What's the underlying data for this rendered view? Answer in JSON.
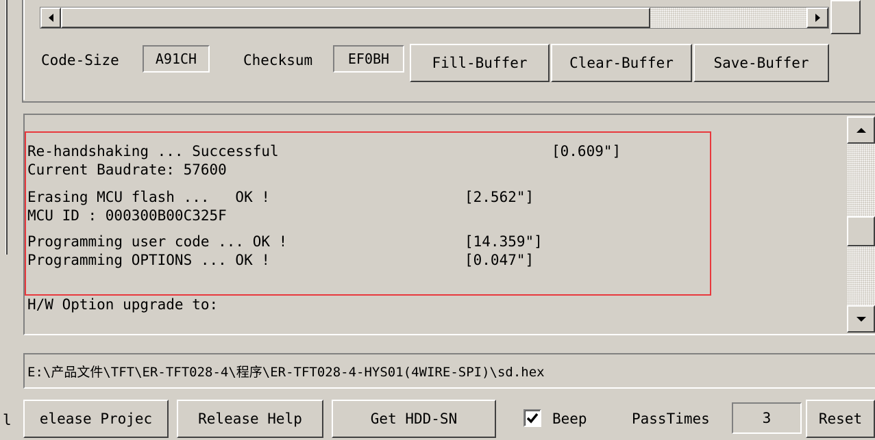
{
  "buffer_panel": {
    "code_size_label": "Code-Size",
    "code_size_value": "A91CH",
    "checksum_label": "Checksum",
    "checksum_value": "EF0BH",
    "fill_buffer": "Fill-Buffer",
    "clear_buffer": "Clear-Buffer",
    "save_buffer": "Save-Buffer"
  },
  "log": {
    "lines": [
      {
        "text": "Re-handshaking ... Successful",
        "time": "[0.609\"]"
      },
      {
        "text": "Current Baudrate: 57600",
        "time": ""
      },
      {
        "text": "Erasing MCU flash ...   OK !",
        "time": "[2.562\"]"
      },
      {
        "text": "MCU ID : 000300B00C325F",
        "time": ""
      },
      {
        "text": "Programming user code ... OK !",
        "time": "[14.359\"]"
      },
      {
        "text": "Programming OPTIONS ... OK !",
        "time": "[0.047\"]"
      },
      {
        "text": "H/W Option upgrade to:",
        "time": ""
      }
    ],
    "highlight_color": "#e8383d"
  },
  "file_path": "E:\\产品文件\\TFT\\ER-TFT028-4\\程序\\ER-TFT028-4-HYS01(4WIRE-SPI)\\sd.hex",
  "bottom_bar": {
    "edge_char": "l",
    "release_project": "elease Projec",
    "release_help": "Release Help",
    "get_hdd_sn": "Get HDD-SN",
    "beep_label": "Beep",
    "beep_checked": true,
    "pass_times_label": "PassTimes",
    "pass_times_value": "3",
    "reset": "Reset"
  },
  "icons": {
    "scroll_left": "triangle-left",
    "scroll_right": "triangle-right",
    "scroll_up": "triangle-up",
    "scroll_down": "triangle-down",
    "check": "checkmark"
  }
}
